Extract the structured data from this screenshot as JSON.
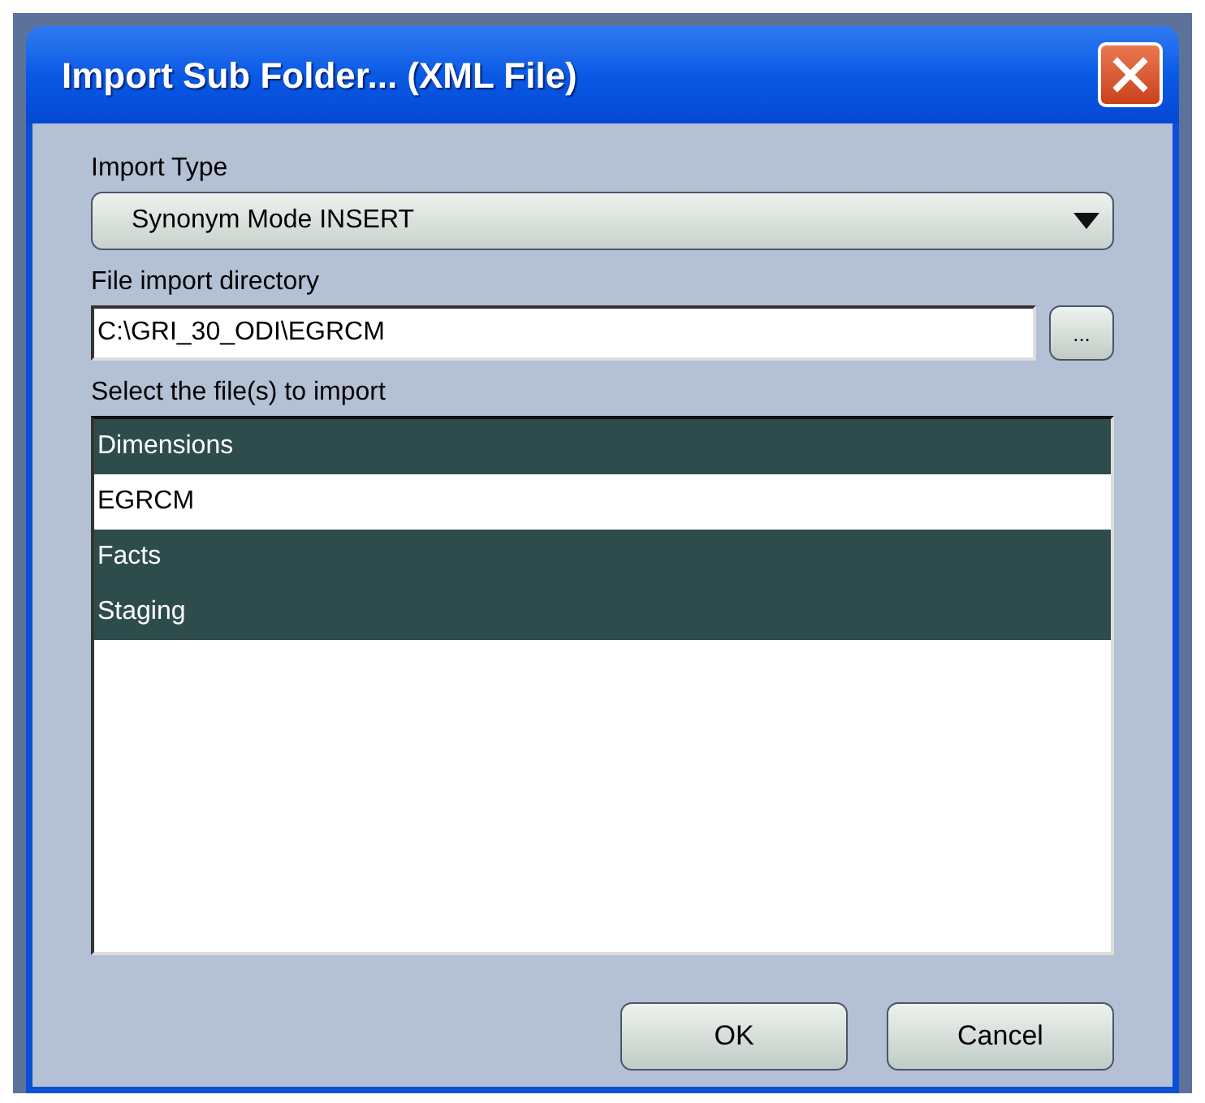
{
  "window": {
    "title": "Import Sub Folder... (XML File)"
  },
  "import_type": {
    "label": "Import Type",
    "value": "Synonym Mode INSERT"
  },
  "directory": {
    "label": "File import directory",
    "value": "C:\\GRI_30_ODI\\EGRCM",
    "browse_label": "..."
  },
  "files": {
    "label": "Select the file(s) to import",
    "items": [
      {
        "name": "Dimensions",
        "selected": true
      },
      {
        "name": "EGRCM",
        "selected": false
      },
      {
        "name": "Facts",
        "selected": true
      },
      {
        "name": "Staging",
        "selected": true
      }
    ]
  },
  "buttons": [
    "OK",
    "Cancel"
  ]
}
